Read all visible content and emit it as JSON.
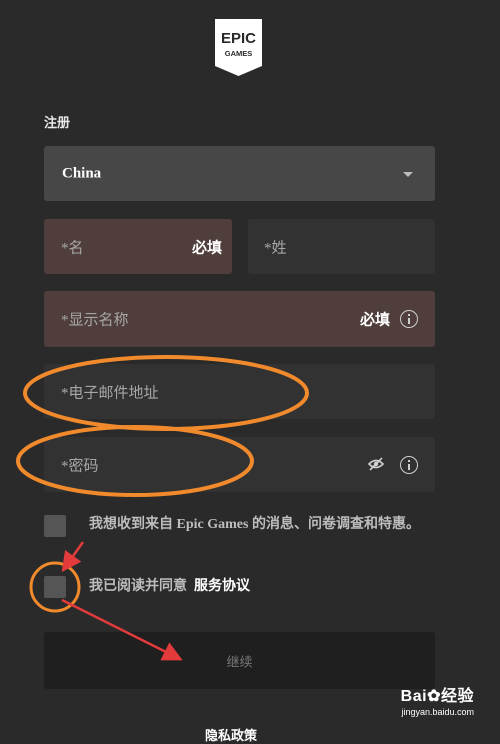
{
  "logo": {
    "line1": "EPIC",
    "line2": "GAMES"
  },
  "form": {
    "section_title": "注册",
    "country": {
      "value": "China"
    },
    "first_name": {
      "placeholder": "*名",
      "required": "必填"
    },
    "last_name": {
      "placeholder": "*姓"
    },
    "display_name": {
      "placeholder": "*显示名称",
      "required": "必填"
    },
    "email": {
      "placeholder": "*电子邮件地址"
    },
    "password": {
      "placeholder": "*密码"
    },
    "newsletter": {
      "label": "我想收到来自 Epic Games 的消息、问卷调查和特惠。",
      "checked": false
    },
    "terms": {
      "label": "我已阅读并同意",
      "link": "服务协议",
      "checked": false
    },
    "continue_label": "继续",
    "bottom_text": "隐私政策"
  },
  "watermark": {
    "brand": "Bai",
    "brand2": "经验",
    "url": "jingyan.baidu.com"
  },
  "colors": {
    "background": "#2a2a2a",
    "required_field_bg": "#4f3e3c",
    "field_bg": "#323232",
    "annotation": "#f08a2c",
    "arrow": "#e33b3b"
  }
}
